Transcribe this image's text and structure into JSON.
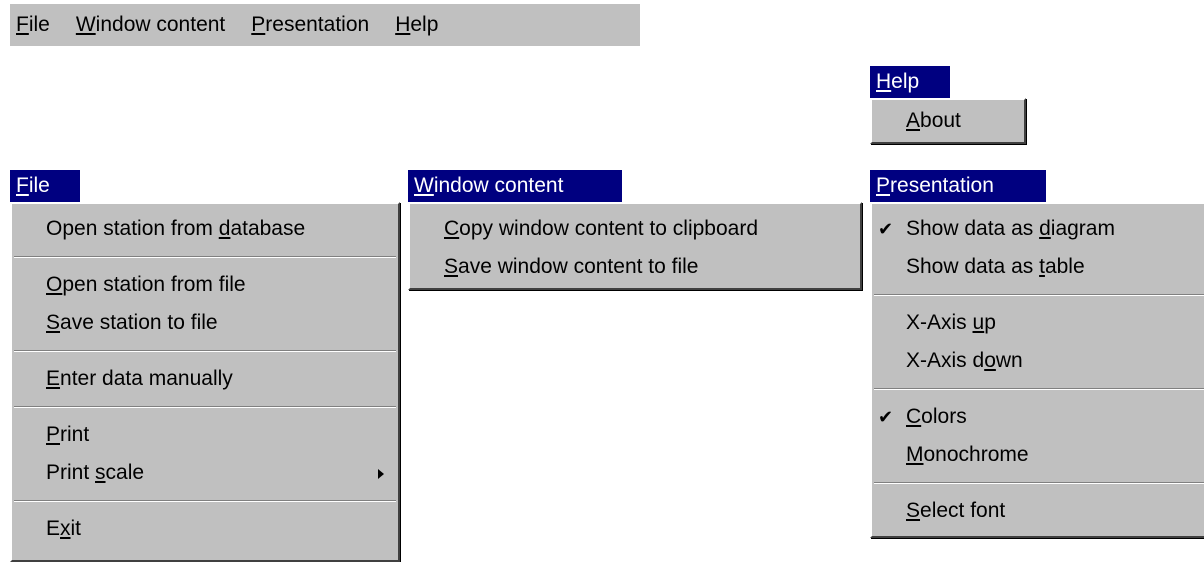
{
  "menubar": {
    "items": [
      {
        "pre": "",
        "key": "F",
        "post": "ile"
      },
      {
        "pre": "",
        "key": "W",
        "post": "indow content"
      },
      {
        "pre": "",
        "key": "P",
        "post": "resentation"
      },
      {
        "pre": "",
        "key": "H",
        "post": "elp"
      }
    ]
  },
  "help_menu": {
    "header": {
      "pre": "",
      "key": "H",
      "post": "elp"
    },
    "items": [
      {
        "pre": "",
        "key": "A",
        "post": "bout"
      }
    ]
  },
  "file_menu": {
    "header": {
      "pre": "",
      "key": "F",
      "post": "ile"
    },
    "items": [
      {
        "pre": "Open station from ",
        "key": "d",
        "post": "atabase"
      },
      {
        "pre": "",
        "key": "O",
        "post": "pen station from file"
      },
      {
        "pre": "",
        "key": "S",
        "post": "ave station to file"
      },
      {
        "pre": "",
        "key": "E",
        "post": "nter data manually"
      },
      {
        "pre": "",
        "key": "P",
        "post": "rint"
      },
      {
        "pre": "Print ",
        "key": "s",
        "post": "cale"
      },
      {
        "pre": "E",
        "key": "x",
        "post": "it"
      }
    ]
  },
  "window_menu": {
    "header": {
      "pre": "",
      "key": "W",
      "post": "indow content"
    },
    "items": [
      {
        "pre": "",
        "key": "C",
        "post": "opy window content to clipboard"
      },
      {
        "pre": "",
        "key": "S",
        "post": "ave window content to file"
      }
    ]
  },
  "presentation_menu": {
    "header": {
      "pre": "",
      "key": "P",
      "post": "resentation"
    },
    "check_glyph": "✔",
    "items": [
      {
        "pre": "Show data as ",
        "key": "d",
        "post": "iagram",
        "checked": true
      },
      {
        "pre": "Show data as ",
        "key": "t",
        "post": "able",
        "checked": false
      },
      {
        "pre": "X-Axis ",
        "key": "u",
        "post": "p",
        "checked": false
      },
      {
        "pre": "X-Axis d",
        "key": "o",
        "post": "wn",
        "checked": false
      },
      {
        "pre": "",
        "key": "C",
        "post": "olors",
        "checked": true
      },
      {
        "pre": "",
        "key": "M",
        "post": "onochrome",
        "checked": false
      },
      {
        "pre": "",
        "key": "S",
        "post": "elect font",
        "checked": false
      }
    ]
  }
}
